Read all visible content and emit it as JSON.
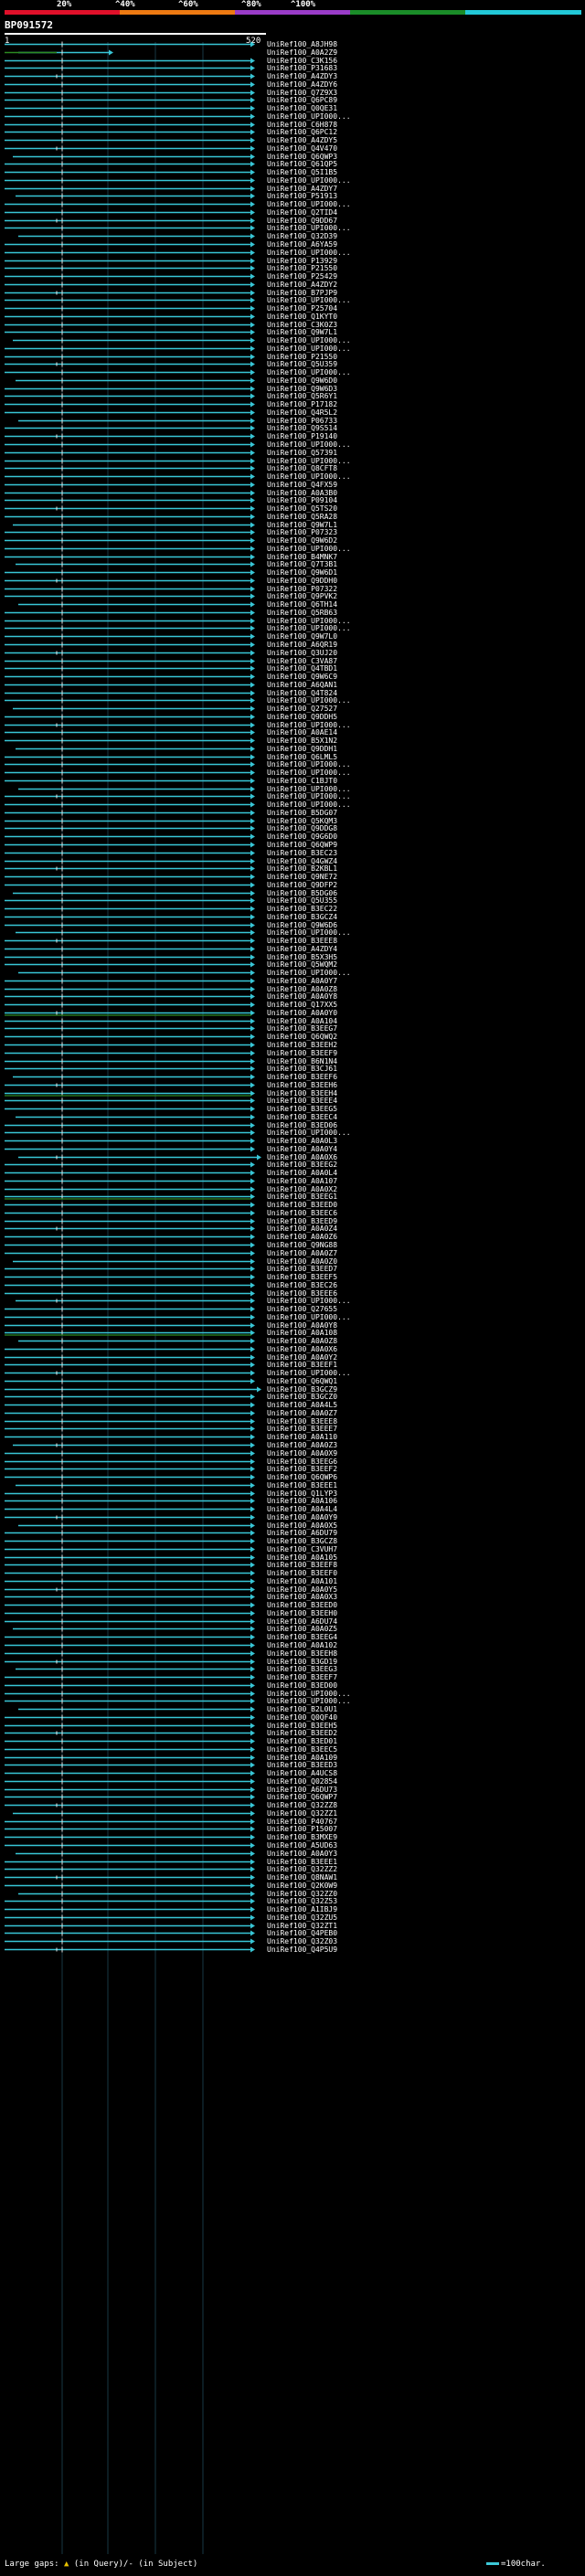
{
  "legend": {
    "colors": [
      "#e0102a",
      "#ee7a12",
      "#9a3cc8",
      "#1a8c28",
      "#22c8d8"
    ],
    "percent_labels": [
      "20%",
      "^40%",
      "^60%",
      "^80%",
      "^100%"
    ]
  },
  "query": {
    "id": "BP091572",
    "start": "1",
    "end": "520"
  },
  "colors": {
    "line": "#38c6d6",
    "tick": "#e8e8e8",
    "green": "#2c8a22",
    "magenta": "#c028c0",
    "dark": "#0a3a4a"
  },
  "hits": [
    "UniRef100_A8JH98",
    "UniRef100_A0A2Z9",
    "UniRef100_C3K156",
    "UniRef100_P31683",
    "UniRef100_A4ZDY3",
    "UniRef100_A4ZDY6",
    "UniRef100_Q7Z9X3",
    "UniRef100_Q6PC89",
    "UniRef100_Q0QE31",
    "UniRef100_UPI000...",
    "UniRef100_C6H878",
    "UniRef100_Q6PC12",
    "UniRef100_A4ZDY5",
    "UniRef100_Q4V470",
    "UniRef100_Q6QWP3",
    "UniRef100_Q61QP5",
    "UniRef100_Q5I1B5",
    "UniRef100_UPI000...",
    "UniRef100_A4ZDY7",
    "UniRef100_P51913",
    "UniRef100_UPI000...",
    "UniRef100_Q2TID4",
    "UniRef100_Q9DD67",
    "UniRef100_UPI000...",
    "UniRef100_Q32D39",
    "UniRef100_A6YA59",
    "UniRef100_UPI000...",
    "UniRef100_P13929",
    "UniRef100_P21550",
    "UniRef100_P25429",
    "UniRef100_A4ZDY2",
    "UniRef100_B7PJP9",
    "UniRef100_UPI000...",
    "UniRef100_P25704",
    "UniRef100_Q1KYT0",
    "UniRef100_C3K0Z3",
    "UniRef100_Q9W7L1",
    "UniRef100_UPI000...",
    "UniRef100_UPI000...",
    "UniRef100_P21550",
    "UniRef100_Q5U359",
    "UniRef100_UPI000...",
    "UniRef100_Q9W6D0",
    "UniRef100_Q9W6D3",
    "UniRef100_Q5R6Y1",
    "UniRef100_P17182",
    "UniRef100_Q4R5L2",
    "UniRef100_P06733",
    "UniRef100_Q9S514",
    "UniRef100_P19140",
    "UniRef100_UPI000...",
    "UniRef100_Q57391",
    "UniRef100_UPI000...",
    "UniRef100_Q8CFT8",
    "UniRef100_UPI000...",
    "UniRef100_Q4FX59",
    "UniRef100_A0A3B0",
    "UniRef100_P09104",
    "UniRef100_Q5TS20",
    "UniRef100_Q5RA28",
    "UniRef100_Q9W7L1",
    "UniRef100_P07323",
    "UniRef100_Q9W6D2",
    "UniRef100_UPI000...",
    "UniRef100_B4MNK7",
    "UniRef100_Q7T3B1",
    "UniRef100_Q9W6D1",
    "UniRef100_Q9DDH0",
    "UniRef100_P07322",
    "UniRef100_Q9PVK2",
    "UniRef100_Q6TH14",
    "UniRef100_Q5RB63",
    "UniRef100_UPI000...",
    "UniRef100_UPI000...",
    "UniRef100_Q9W7L0",
    "UniRef100_A6QR19",
    "UniRef100_Q3UJ20",
    "UniRef100_C3VA87",
    "UniRef100_Q4TBD1",
    "UniRef100_Q9W6C9",
    "UniRef100_A6QAN1",
    "UniRef100_Q4T824",
    "UniRef100_UPI000...",
    "UniRef100_Q27527",
    "UniRef100_Q9DDH5",
    "UniRef100_UPI000...",
    "UniRef100_A0AE14",
    "UniRef100_B5X1N2",
    "UniRef100_Q9DDH1",
    "UniRef100_Q6LML5",
    "UniRef100_UPI000...",
    "UniRef100_UPI000...",
    "UniRef100_C1BJT0",
    "UniRef100_UPI000...",
    "UniRef100_UPI000...",
    "UniRef100_UPI000...",
    "UniRef100_B5DG07",
    "UniRef100_Q5KQM3",
    "UniRef100_Q9DDG8",
    "UniRef100_Q9G6D0",
    "UniRef100_Q6QWP9",
    "UniRef100_B3EC23",
    "UniRef100_Q4GWZ4",
    "UniRef100_B2KBL1",
    "UniRef100_Q9NE72",
    "UniRef100_Q9DFP2",
    "UniRef100_B5DG06",
    "UniRef100_Q5U355",
    "UniRef100_B3EC22",
    "UniRef100_B3GCZ4",
    "UniRef100_Q9W6D6",
    "UniRef100_UPI000...",
    "UniRef100_B3EEE8",
    "UniRef100_A4ZDY4",
    "UniRef100_B5X3H5",
    "UniRef100_Q5WQM2",
    "UniRef100_UPI000...",
    "UniRef100_A0A0Y7",
    "UniRef100_A0A0Z8",
    "UniRef100_A0A0Y8",
    "UniRef100_Q17XX5",
    "UniRef100_A0A0Y0",
    "UniRef100_A0A104",
    "UniRef100_B3EEG7",
    "UniRef100_Q6QWQ2",
    "UniRef100_B3EEH2",
    "UniRef100_B3EEF9",
    "UniRef100_B6N1N4",
    "UniRef100_B3CJ61",
    "UniRef100_B3EEF6",
    "UniRef100_B3EEH6",
    "UniRef100_B3EEH4",
    "UniRef100_B3EEE4",
    "UniRef100_B3EEG5",
    "UniRef100_B3EEC4",
    "UniRef100_B3ED06",
    "UniRef100_UPI000...",
    "UniRef100_A0A0L3",
    "UniRef100_A0A0Y4",
    "UniRef100_A0A0X6",
    "UniRef100_B3EEG2",
    "UniRef100_A0A0L4",
    "UniRef100_A0A107",
    "UniRef100_A0A0X2",
    "UniRef100_B3EEG1",
    "UniRef100_B3EED0",
    "UniRef100_B3EEC6",
    "UniRef100_B3EED9",
    "UniRef100_A0A0Z4",
    "UniRef100_A0A0Z6",
    "UniRef100_Q9NG88",
    "UniRef100_A0A0Z7",
    "UniRef100_A0A0Z0",
    "UniRef100_B3EED7",
    "UniRef100_B3EEF5",
    "UniRef100_B3EC26",
    "UniRef100_B3EEE6",
    "UniRef100_UPI000...",
    "UniRef100_Q27655",
    "UniRef100_UPI000...",
    "UniRef100_A0A0Y8",
    "UniRef100_A0A108",
    "UniRef100_A0A0Z8",
    "UniRef100_A0A0X6",
    "UniRef100_A0A0Y2",
    "UniRef100_B3EEF1",
    "UniRef100_UPI000...",
    "UniRef100_Q6QWQ1",
    "UniRef100_B3GCZ9",
    "UniRef100_B3GCZ0",
    "UniRef100_A0A4L5",
    "UniRef100_A0A0Z7",
    "UniRef100_B3EEE8",
    "UniRef100_B3EEE7",
    "UniRef100_A0A110",
    "UniRef100_A0A0Z3",
    "UniRef100_A0A0X9",
    "UniRef100_B3EEG6",
    "UniRef100_B3EEF2",
    "UniRef100_Q6QWP6",
    "UniRef100_B3EEE1",
    "UniRef100_Q1LYP3",
    "UniRef100_A0A106",
    "UniRef100_A0A4L4",
    "UniRef100_A0A0Y9",
    "UniRef100_A0A0X5",
    "UniRef100_A6DU79",
    "UniRef100_B3GCZ8",
    "UniRef100_C3VUH7",
    "UniRef100_A0A105",
    "UniRef100_B3EEF8",
    "UniRef100_B3EEF0",
    "UniRef100_A0A101",
    "UniRef100_A0A0Y5",
    "UniRef100_A0A0X3",
    "UniRef100_B3EED0",
    "UniRef100_B3EEH0",
    "UniRef100_A6DU74",
    "UniRef100_A0A0Z5",
    "UniRef100_B3EEG4",
    "UniRef100_A0A102",
    "UniRef100_B3EEH8",
    "UniRef100_B3GD19",
    "UniRef100_B3EEG3",
    "UniRef100_B3EEF7",
    "UniRef100_B3ED00",
    "UniRef100_UPI000...",
    "UniRef100_UPI000...",
    "UniRef100_B2L0U1",
    "UniRef100_Q0QF40",
    "UniRef100_B3EEH5",
    "UniRef100_B3EED2",
    "UniRef100_B3ED01",
    "UniRef100_B3EEC5",
    "UniRef100_A0A109",
    "UniRef100_B3EED3",
    "UniRef100_A4UCS8",
    "UniRef100_Q02854",
    "UniRef100_A6DU73",
    "UniRef100_Q6QWP7",
    "UniRef100_Q32ZZ8",
    "UniRef100_Q32ZZ1",
    "UniRef100_P40767",
    "UniRef100_P15007",
    "UniRef100_B3MXE9",
    "UniRef100_A5UD63",
    "UniRef100_A0A0Y3",
    "UniRef100_B3EEE1",
    "UniRef100_Q32ZZ2",
    "UniRef100_Q8NAW1",
    "UniRef100_Q2K0W9",
    "UniRef100_Q32ZZ0",
    "UniRef100_Q32Z53",
    "UniRef100_A1IBJ9",
    "UniRef100_Q32ZU5",
    "UniRef100_Q32ZT1",
    "UniRef100_Q4PEB0",
    "UniRef100_Q32Z03",
    "UniRef100_Q4P5U9"
  ],
  "footer": {
    "gaps_label": "Large gaps:",
    "gaps_text": "(in Query)/- (in Subject)",
    "scale_label": "=100char."
  }
}
